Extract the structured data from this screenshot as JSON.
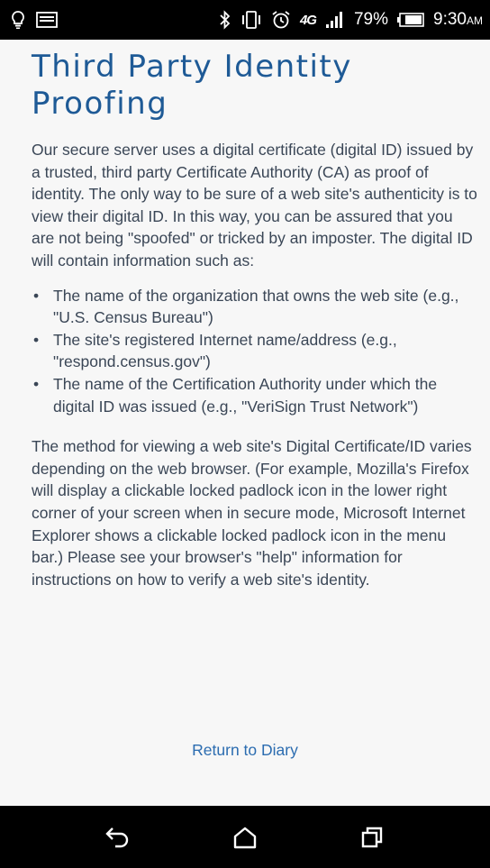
{
  "status_bar": {
    "left_icons": [
      "bulb-icon",
      "message-icon"
    ],
    "right_icons": [
      "bluetooth-icon",
      "vibrate-icon",
      "alarm-icon",
      "network-4g-icon",
      "signal-icon",
      "battery-icon"
    ],
    "network_label": "4G",
    "battery_percent": "79%",
    "time": "9:30",
    "ampm": "AM"
  },
  "page": {
    "title": "Third Party Identity Proofing",
    "intro": "Our secure server uses a digital certificate (digital ID) issued by a trusted, third party Certificate Authority (CA) as proof of identity. The only way to be sure of a web site's authenticity is to view their digital ID. In this way, you can be assured that you are not being \"spoofed\" or tricked by an imposter. The digital ID will contain information such as:",
    "bullets": [
      "The name of the organization that owns the web site (e.g., \"U.S. Census Bureau\")",
      "The site's registered Internet name/address (e.g., \"respond.census.gov\")",
      "The name of the Certification Authority under which the digital ID was issued (e.g., \"VeriSign Trust Network\")"
    ],
    "method": "The method for viewing a web site's Digital Certificate/ID varies depending on the web browser. (For example, Mozilla's Firefox will display a clickable locked padlock icon in the lower right corner of your screen when in secure mode, Microsoft Internet Explorer shows a clickable locked padlock icon in the menu bar.) Please see your browser's \"help\" information for instructions on how to verify a web site's identity.",
    "return_link": "Return to Diary",
    "bullet_glyph": "•"
  },
  "nav_bar": {
    "icons": [
      "back-icon",
      "home-icon",
      "recent-apps-icon"
    ]
  },
  "colors": {
    "title": "#1e5a96",
    "body_text": "#3a4656",
    "link": "#2b6cb0",
    "background": "#f7f7f7",
    "bars": "#000000"
  }
}
